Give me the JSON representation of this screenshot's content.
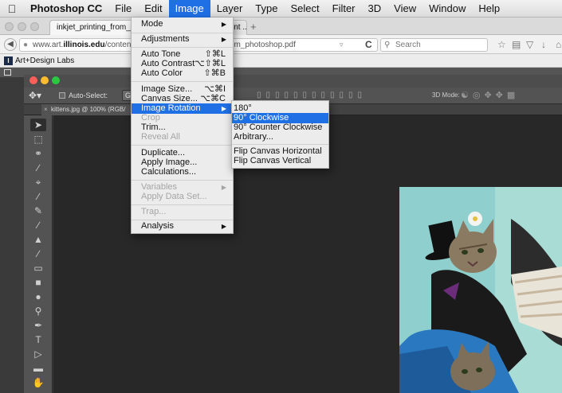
{
  "menubar": {
    "apple_icon": "apple-icon",
    "items": [
      "Photoshop CC",
      "File",
      "Edit",
      "Image",
      "Layer",
      "Type",
      "Select",
      "Filter",
      "3D",
      "View",
      "Window",
      "Help"
    ],
    "active": "Image"
  },
  "browser": {
    "tabs": [
      "inkjet_printing_from_photosho",
      "int ... ×",
      "+"
    ],
    "url_prefix": "www.art.",
    "url_domain": "illinois.edu",
    "url_suffix": "/content/resou",
    "url_tail": "om_photoshop.pdf",
    "search_placeholder": "Search",
    "bookmark": "Art+Design Labs",
    "bookmark_icon_letter": "I"
  },
  "photoshop": {
    "options_bar": {
      "auto_select_label": "Auto-Select:",
      "auto_select_value": "Group",
      "mode3d_label": "3D Mode:"
    },
    "doc_tab": "kittens.jpg @ 100% (RGB/",
    "doc_tab_close": "×",
    "tools": [
      "move-tool",
      "marquee-tool",
      "lasso-tool",
      "quick-select-tool",
      "crop-tool",
      "eyedropper-tool",
      "healing-brush-tool",
      "brush-tool",
      "clone-stamp-tool",
      "history-brush-tool",
      "eraser-tool",
      "gradient-tool",
      "blur-tool",
      "dodge-tool",
      "pen-tool",
      "type-tool",
      "path-select-tool",
      "rectangle-tool",
      "hand-tool",
      "zoom-tool"
    ]
  },
  "image_menu": {
    "mode": "Mode",
    "adjustments": "Adjustments",
    "auto_tone": "Auto Tone",
    "auto_tone_sc": "⇧⌘L",
    "auto_contrast": "Auto Contrast",
    "auto_contrast_sc": "⌥⇧⌘L",
    "auto_color": "Auto Color",
    "auto_color_sc": "⇧⌘B",
    "image_size": "Image Size...",
    "image_size_sc": "⌥⌘I",
    "canvas_size": "Canvas Size...",
    "canvas_size_sc": "⌥⌘C",
    "image_rotation": "Image Rotation",
    "crop": "Crop",
    "trim": "Trim...",
    "reveal_all": "Reveal All",
    "duplicate": "Duplicate...",
    "apply_image": "Apply Image...",
    "calculations": "Calculations...",
    "variables": "Variables",
    "apply_data_set": "Apply Data Set...",
    "trap": "Trap...",
    "analysis": "Analysis"
  },
  "rotation_submenu": {
    "items": [
      "180°",
      "90° Clockwise",
      "90° Counter Clockwise",
      "Arbitrary...",
      "Flip Canvas Horizontal",
      "Flip Canvas Vertical"
    ],
    "highlighted": "90° Clockwise"
  },
  "colors": {
    "menu_highlight": "#1f6fe5",
    "ps_panel": "#535353",
    "canvas_bg": "#282828",
    "photo_bg": "#8fd0ce"
  }
}
